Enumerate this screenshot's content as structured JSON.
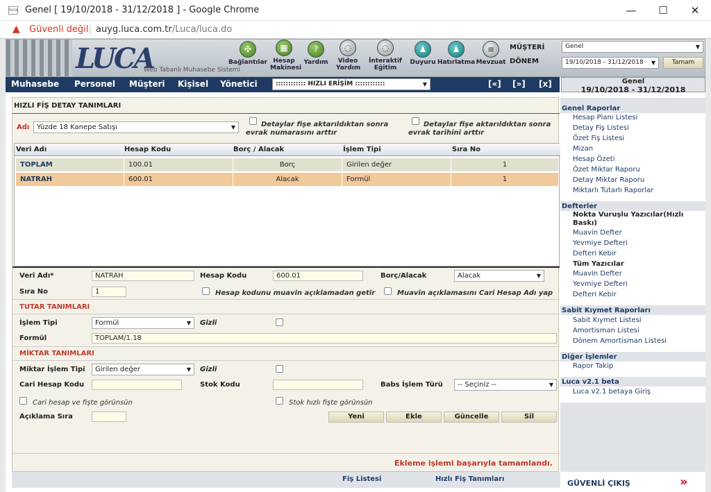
{
  "browser": {
    "window_title": "Genel [ 19/10/2018 - 31/12/2018 ] - Google Chrome",
    "favicon_text": "luca",
    "security_label": "Güvenli değil",
    "url_host": "auyg.luca.com.tr",
    "url_path": "/Luca/luca.do",
    "minimize": "—",
    "maximize": "☐",
    "close": "✕"
  },
  "header": {
    "logo": "LUCA",
    "tagline": "Web Tabanlı Muhasebe Sistemi",
    "tools": [
      {
        "label": "Bağlantılar",
        "icon": "links-icon"
      },
      {
        "label": "Hesap Makinesi",
        "icon": "calculator-icon"
      },
      {
        "label": "Yardım",
        "icon": "help-icon"
      },
      {
        "label": "Video Yardım",
        "icon": "video-help-icon"
      },
      {
        "label": "İnteraktif Eğitim",
        "icon": "interactive-training-icon"
      },
      {
        "label": "Duyuru",
        "icon": "announcement-icon"
      },
      {
        "label": "Hatırlatma",
        "icon": "reminder-icon"
      },
      {
        "label": "Mevzuat",
        "icon": "legislation-icon"
      }
    ],
    "musteri_label": "MÜŞTERİ",
    "musteri_value": "Genel",
    "donem_label": "DÖNEM",
    "donem_value": "19/10/2018 - 31/12/2018",
    "tamam": "Tamam"
  },
  "nav": {
    "items": [
      "Muhasebe",
      "Personel",
      "Müşteri",
      "Kişisel",
      "Yönetici"
    ],
    "quick_access": ":::::::::::: HIZLI ERİŞİM ::::::::::::",
    "prev": "[«]",
    "next": "[»]",
    "close": "[x]",
    "period_title": "Genel",
    "period_range": "19/10/2018 - 31/12/2018"
  },
  "panel": {
    "title": "HIZLI FİŞ DETAY TANIMLARI",
    "adi_label": "Adı",
    "adi_value": "Yüzde 18 Kanepe Satışı",
    "chk_evrak_no": "Detaylar fişe aktarıldıktan sonra evrak numarasını arttır",
    "chk_evrak_tarih": "Detaylar fişe aktarıldıktan sonra evrak tarihini arttır"
  },
  "grid": {
    "columns": [
      "Veri Adı",
      "Hesap Kodu",
      "Borç / Alacak",
      "İşlem Tipi",
      "Sıra No"
    ],
    "rows": [
      [
        "TOPLAM",
        "100.01",
        "Borç",
        "Girilen değer",
        "1"
      ],
      [
        "NATRAH",
        "600.01",
        "Alacak",
        "Formül",
        "1"
      ]
    ]
  },
  "form": {
    "veri_adi_label": "Veri Adı*",
    "veri_adi_value": "NATRAH",
    "hesap_kodu_label": "Hesap Kodu",
    "hesap_kodu_value": "600.01",
    "borc_alacak_label": "Borç/Alacak",
    "borc_alacak_value": "Alacak",
    "sira_no_label": "Sıra No",
    "sira_no_value": "1",
    "chk_muavin": "Hesap kodunu muavin açıklamadan getir",
    "chk_cari": "Muavin açıklamasını Cari Hesap Adı yap",
    "tutar_title": "TUTAR TANIMLARI",
    "islem_tipi_label": "İşlem Tipi",
    "islem_tipi_value": "Formül",
    "gizli_label": "Gizli",
    "formul_label": "Formül",
    "formul_value": "TOPLAM/1.18",
    "miktar_title": "MİKTAR TANIMLARI",
    "miktar_islem_label": "Miktar İşlem Tipi",
    "miktar_islem_value": "Girilen değer",
    "gizli2_label": "Gizli",
    "cari_hesap_label": "Cari Hesap Kodu",
    "stok_kodu_label": "Stok Kodu",
    "babs_label": "Babs İşlem Türü",
    "babs_value": "-- Seçiniz --",
    "chk_cari_fis": "Cari hesap ve fişte görünsün",
    "chk_stok_fis": "Stok hızlı fişte görünsün",
    "aciklama_label": "Açıklama Sıra",
    "btn_yeni": "Yeni",
    "btn_ekle": "Ekle",
    "btn_guncelle": "Güncelle",
    "btn_sil": "Sil",
    "status": "Ekleme işlemi başarıyla tamamlandı."
  },
  "footer": {
    "fis_listesi": "Fiş Listesi",
    "hizli_fis": "Hızlı Fiş Tanımları"
  },
  "sidebar": {
    "genel_title": "Genel Raporlar",
    "genel_items": [
      "Hesap Planı Listesi",
      "Detay Fiş Listesi",
      "Özet Fiş Listesi",
      "Mizan",
      "Hesap Özeti",
      "Özet Miktar Raporu",
      "Detay Miktar Raporu",
      "Miktarlı Tutarlı Raporlar"
    ],
    "defterler_title": "Defterler",
    "nokta_title": "Nokta Vuruşlu Yazıcılar(Hızlı Baskı)",
    "nokta_items": [
      "Muavin Defter",
      "Yevmiye Defteri",
      "Defteri Kebir"
    ],
    "tum_title": "Tüm Yazıcılar",
    "tum_items": [
      "Muavin Defter",
      "Yevmiye Defteri",
      "Defteri Kebir"
    ],
    "sabit_title": "Sabit Kıymet Raporları",
    "sabit_items": [
      "Sabit Kıymet Listesi",
      "Amortisman Listesi",
      "Dönem Amortisman Listesi"
    ],
    "diger_title": "Diğer İşlemler",
    "diger_items": [
      "Rapor Takip"
    ],
    "beta_title": "Luca v2.1 beta",
    "beta_items": [
      "Luca v2.1 betaya Giriş"
    ],
    "exit": "GÜVENLİ ÇIKIŞ",
    "exit_arrow": "»"
  },
  "colors": {
    "nav": "#1f3b64",
    "row_selected": "#f2c99a",
    "row_normal": "#dfe1cf",
    "accent_red": "#c0392b"
  }
}
